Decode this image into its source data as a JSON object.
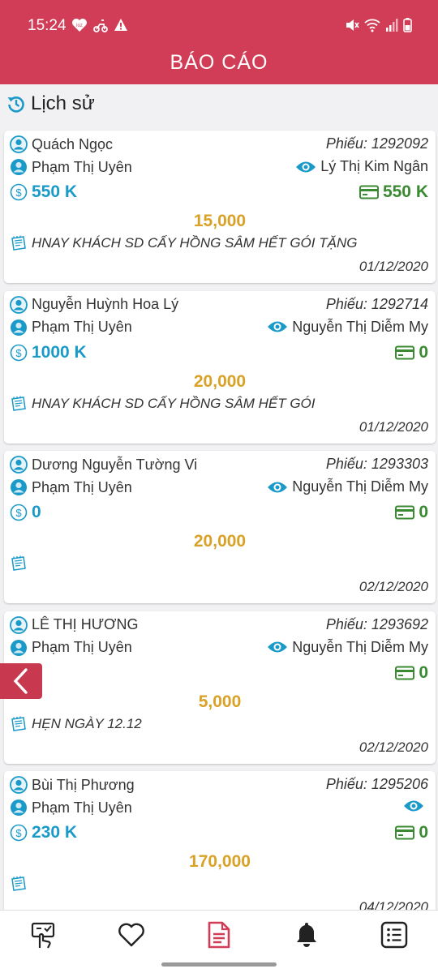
{
  "status_bar": {
    "time": "15:24"
  },
  "header": {
    "title": "BÁO CÁO"
  },
  "history": {
    "label": "Lịch sử"
  },
  "colors": {
    "brand": "#d13c56",
    "money_blue": "#1a9ac8",
    "money_green": "#3a8a32",
    "amount": "#d9a126"
  },
  "cards": [
    {
      "customer": "Quách Ngọc",
      "ticket": "Phiếu: 1292092",
      "staff": "Phạm Thị Uyên",
      "viewer": "Lý Thị Kim Ngân",
      "cash": "550 K",
      "card": "550 K",
      "amount": "15,000",
      "note": "HNAY KHÁCH SD CẤY HỒNG SÂM HẾT GÓI TẶNG",
      "date": "01/12/2020"
    },
    {
      "customer": "Nguyễn Huỳnh Hoa Lý",
      "ticket": "Phiếu: 1292714",
      "staff": "Phạm Thị Uyên",
      "viewer": "Nguyễn Thị Diễm My",
      "cash": "1000 K",
      "card": "0",
      "amount": "20,000",
      "note": "HNAY KHÁCH SD CẤY HỒNG SÂM HẾT GÓI",
      "date": "01/12/2020"
    },
    {
      "customer": "Dương Nguyễn Tường Vi",
      "ticket": "Phiếu: 1293303",
      "staff": "Phạm Thị Uyên",
      "viewer": "Nguyễn Thị Diễm My",
      "cash": "0",
      "card": "0",
      "amount": "20,000",
      "note": "",
      "date": "02/12/2020"
    },
    {
      "customer": "LÊ THỊ HƯƠNG",
      "ticket": "Phiếu: 1293692",
      "staff": "Phạm Thị Uyên",
      "viewer": "Nguyễn Thị Diễm My",
      "cash": "0",
      "card": "0",
      "amount": "5,000",
      "note": "HẸN NGÀY 12.12",
      "date": "02/12/2020"
    },
    {
      "customer": "Bùi Thị Phương",
      "ticket": "Phiếu: 1295206",
      "staff": "Phạm Thị Uyên",
      "viewer": "",
      "cash": "230 K",
      "card": "0",
      "amount": "170,000",
      "note": "",
      "date": "04/12/2020"
    }
  ],
  "bottom_nav": [
    {
      "icon": "touch-checklist-icon"
    },
    {
      "icon": "heart-icon"
    },
    {
      "icon": "report-document-icon",
      "active": true
    },
    {
      "icon": "bell-icon"
    },
    {
      "icon": "list-menu-icon"
    }
  ]
}
